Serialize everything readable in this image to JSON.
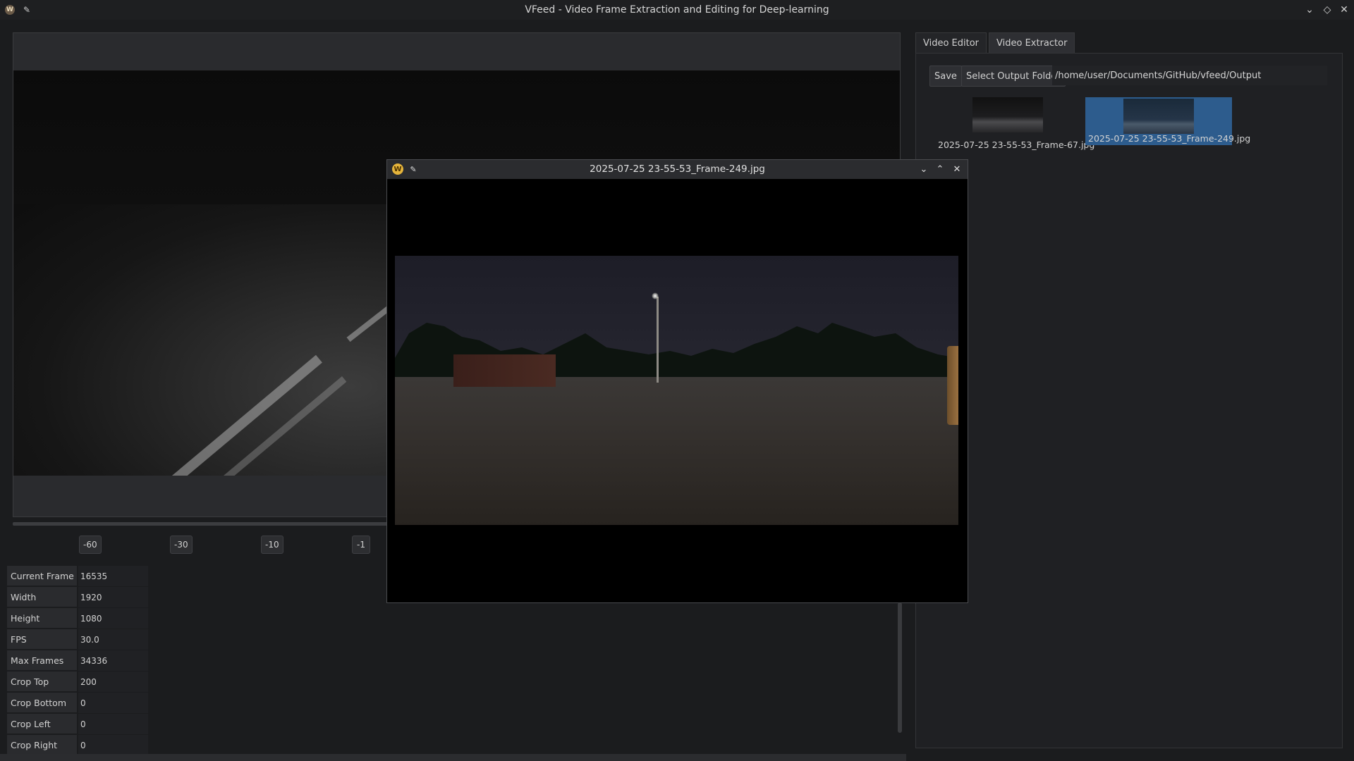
{
  "window": {
    "title": "VFeed - Video Frame Extraction and Editing for Deep-learning",
    "logo_icon": "app-logo-icon",
    "pin_icon": "pin-icon",
    "controls": [
      "minimize-icon",
      "maximize-icon",
      "close-icon"
    ]
  },
  "player": {
    "step_buttons": [
      "-60",
      "-30",
      "-10",
      "-1"
    ]
  },
  "properties": [
    {
      "label": "Current Frame",
      "value": "16535"
    },
    {
      "label": "Width",
      "value": "1920"
    },
    {
      "label": "Height",
      "value": "1080"
    },
    {
      "label": "FPS",
      "value": "30.0"
    },
    {
      "label": "Max Frames",
      "value": "34336"
    },
    {
      "label": "Crop Top",
      "value": "200"
    },
    {
      "label": "Crop Bottom",
      "value": "0"
    },
    {
      "label": "Crop Left",
      "value": "0"
    },
    {
      "label": "Crop Right",
      "value": "0"
    }
  ],
  "right_panel": {
    "tabs": [
      {
        "label": "Video Editor",
        "active": false
      },
      {
        "label": "Video Extractor",
        "active": true
      }
    ],
    "save_label": "Save",
    "select_output_label": "Select Output Folder",
    "output_path": "/home/user/Documents/GitHub/vfeed/Output",
    "thumbnails": [
      {
        "caption": "2025-07-25 23-55-53_Frame-67.jpg",
        "selected": false
      },
      {
        "caption": "2025-07-25 23-55-53_Frame-249.jpg",
        "selected": true
      }
    ]
  },
  "preview_dialog": {
    "title": "2025-07-25 23-55-53_Frame-249.jpg"
  },
  "colors": {
    "selection": "#2d5c8d",
    "background": "#1b1c1e",
    "dialog_logo": "#e5b43b"
  }
}
